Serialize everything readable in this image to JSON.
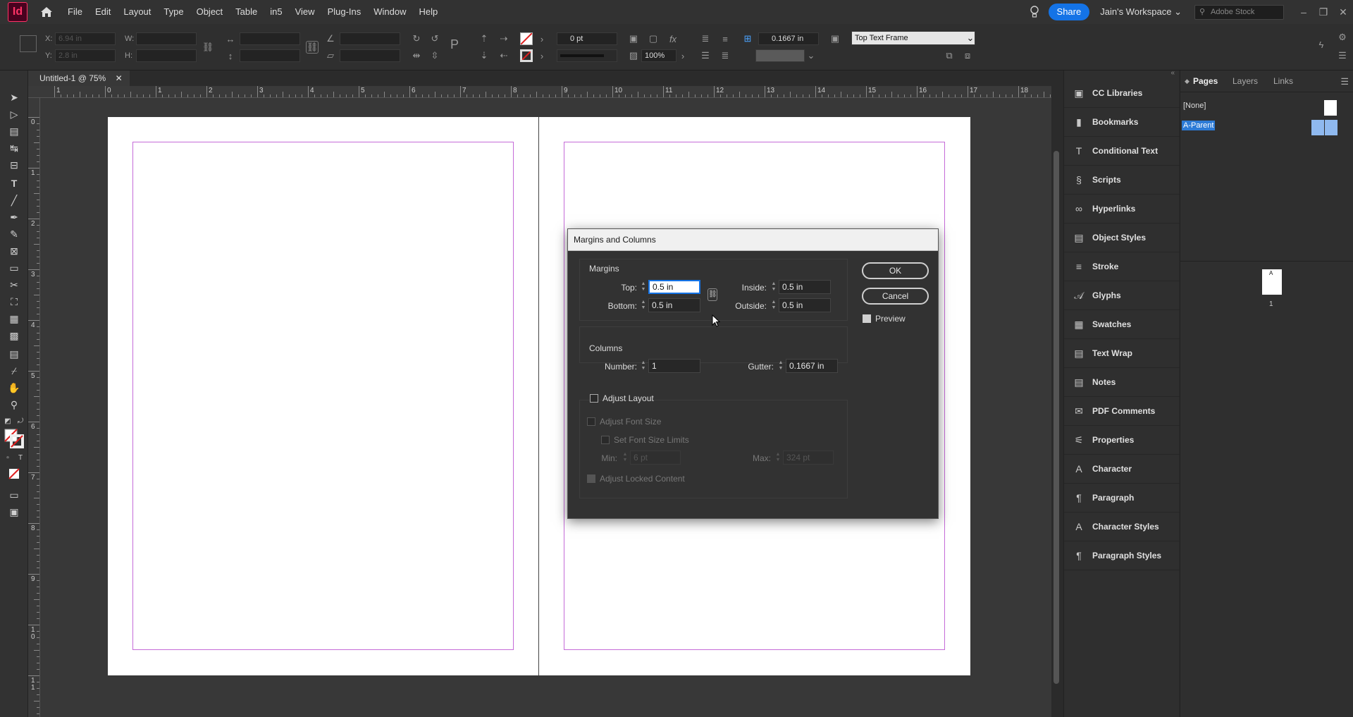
{
  "app": {
    "logo": "Id",
    "title_tab": "Untitled-1 @ 75%"
  },
  "menu": [
    "File",
    "Edit",
    "Layout",
    "Type",
    "Object",
    "Table",
    "in5",
    "View",
    "Plug-Ins",
    "Window",
    "Help"
  ],
  "menubar_right": {
    "share": "Share",
    "workspace": "Jain's Workspace",
    "stock_placeholder": "Adobe Stock"
  },
  "control": {
    "x_label": "X:",
    "x_value": "6.94 in",
    "y_label": "Y:",
    "y_value": "2.8 in",
    "w_label": "W:",
    "h_label": "H:",
    "stroke_weight": "0 pt",
    "opacity": "100%",
    "gutter": "0.1667 in",
    "text_frame_option": "Top Text Frame"
  },
  "rulers": {
    "h": [
      "1",
      "0",
      "1",
      "2",
      "3",
      "4",
      "5",
      "6",
      "7",
      "8",
      "9",
      "10",
      "11",
      "12",
      "13",
      "14",
      "15",
      "16",
      "17",
      "18"
    ],
    "v": [
      "0",
      "1",
      "2",
      "3",
      "4",
      "5",
      "6",
      "7",
      "8",
      "9",
      "1\n0",
      "1\n1"
    ]
  },
  "dialog": {
    "title": "Margins and Columns",
    "margins_heading": "Margins",
    "top_label": "Top:",
    "top_value": "0.5 in",
    "bottom_label": "Bottom:",
    "bottom_value": "0.5 in",
    "inside_label": "Inside:",
    "inside_value": "0.5 in",
    "outside_label": "Outside:",
    "outside_value": "0.5 in",
    "columns_heading": "Columns",
    "number_label": "Number:",
    "number_value": "1",
    "gutter_label": "Gutter:",
    "gutter_value": "0.1667 in",
    "adjust_layout": "Adjust Layout",
    "adjust_font_size": "Adjust Font Size",
    "set_font_size_limits": "Set Font Size Limits",
    "min_label": "Min:",
    "min_value": "6 pt",
    "max_label": "Max:",
    "max_value": "324 pt",
    "adjust_locked_content": "Adjust Locked Content",
    "ok": "OK",
    "cancel": "Cancel",
    "preview": "Preview"
  },
  "panels": [
    {
      "label": "CC Libraries",
      "icon": "cc-libraries-icon"
    },
    {
      "label": "Bookmarks",
      "icon": "bookmark-icon"
    },
    {
      "label": "Conditional Text",
      "icon": "conditional-text-icon"
    },
    {
      "label": "Scripts",
      "icon": "scripts-icon"
    },
    {
      "label": "Hyperlinks",
      "icon": "hyperlinks-icon"
    },
    {
      "label": "Object Styles",
      "icon": "object-styles-icon"
    },
    {
      "label": "Stroke",
      "icon": "stroke-icon"
    },
    {
      "label": "Glyphs",
      "icon": "glyphs-icon"
    },
    {
      "label": "Swatches",
      "icon": "swatches-icon"
    },
    {
      "label": "Text Wrap",
      "icon": "text-wrap-icon"
    },
    {
      "label": "Notes",
      "icon": "notes-icon"
    },
    {
      "label": "PDF Comments",
      "icon": "pdf-comments-icon"
    },
    {
      "label": "Properties",
      "icon": "properties-icon"
    },
    {
      "label": "Character",
      "icon": "character-icon"
    },
    {
      "label": "Paragraph",
      "icon": "paragraph-icon"
    },
    {
      "label": "Character Styles",
      "icon": "character-styles-icon"
    },
    {
      "label": "Paragraph Styles",
      "icon": "paragraph-styles-icon"
    }
  ],
  "pages_panel": {
    "tabs": [
      "Pages",
      "Layers",
      "Links"
    ],
    "none_label": "[None]",
    "parent_label": "A-Parent",
    "thumb_letter": "A",
    "page_number": "1"
  },
  "colors": {
    "accent": "#1473e6",
    "margin_guide": "#c56bd8",
    "logo": "#ff3366"
  }
}
